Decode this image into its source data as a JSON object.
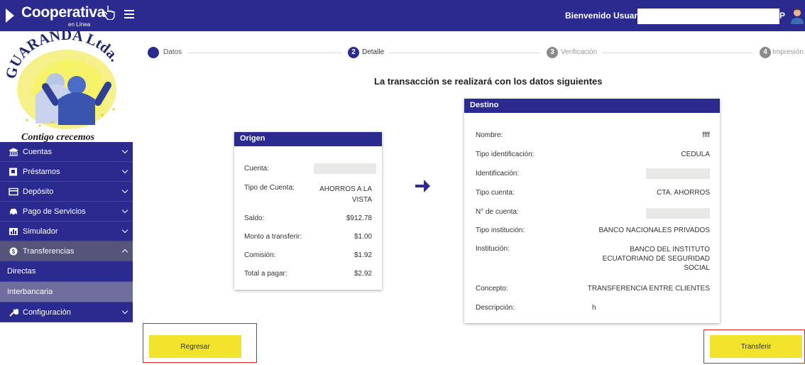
{
  "topbar": {
    "brand": "Cooperativa",
    "brand_sub": "en Línea",
    "welcome": "Bienvenido Usuario: F",
    "welcome_tail": "P"
  },
  "sidebar": {
    "logo_arc_text": "GUARANDA Ltda.",
    "logo_slogan": "Contigo crecemos",
    "items": [
      {
        "label": "Cuentas",
        "icon": "bank-icon"
      },
      {
        "label": "Préstamos",
        "icon": "document-icon"
      },
      {
        "label": "Depósito",
        "icon": "card-icon"
      },
      {
        "label": "Pago de Servicios",
        "icon": "car-icon"
      },
      {
        "label": "Simulador",
        "icon": "chart-icon"
      },
      {
        "label": "Transferencias",
        "icon": "dollar-circle-icon"
      }
    ],
    "sub_items": [
      {
        "label": "Directas"
      },
      {
        "label": "Interbancaria"
      }
    ],
    "config": {
      "label": "Configuración",
      "icon": "wrench-icon"
    }
  },
  "stepper": {
    "steps": [
      {
        "number": "",
        "label": "Datos",
        "color": "#2b2a8f"
      },
      {
        "number": "2",
        "label": "Detalle",
        "color": "#2b2a8f"
      },
      {
        "number": "3",
        "label": "Verificación",
        "color": "#8a8a8a"
      },
      {
        "number": "4",
        "label": "Impresión",
        "color": "#8a8a8a"
      }
    ]
  },
  "headline": "La transacción se realizará con los datos siguientes",
  "origen": {
    "title": "Origen",
    "rows": [
      {
        "label": "Cuenta:",
        "value": ""
      },
      {
        "label": "Tipo de Cuenta:",
        "value": "AHORROS A LA VISTA"
      },
      {
        "label": "Saldo:",
        "value": "$912.78"
      },
      {
        "label": "Monto a transferir:",
        "value": "$1.00"
      },
      {
        "label": "Comisión:",
        "value": "$1.92"
      },
      {
        "label": "Total a pagar:",
        "value": "$2.92"
      }
    ]
  },
  "destino": {
    "title": "Destino",
    "rows": [
      {
        "label": "Nombre:",
        "value": "ffff"
      },
      {
        "label": "Tipo identificación:",
        "value": "CEDULA"
      },
      {
        "label": "Identificación:",
        "value": ""
      },
      {
        "label": "Tipo cuenta:",
        "value": "CTA. AHORROS"
      },
      {
        "label": "N° de cuenta:",
        "value": ""
      },
      {
        "label": "Tipo institución:",
        "value": "BANCO NACIONALES PRIVADOS"
      },
      {
        "label": "Institución:",
        "value": "BANCO DEL INSTITUTO ECUATORIANO DE SEGURIDAD SOCIAL"
      },
      {
        "label": "Concepto:",
        "value": "TRANSFERENCIA ENTRE CLIENTES"
      },
      {
        "label": "Descripción:",
        "value": "h"
      }
    ]
  },
  "buttons": {
    "back": "Regresar",
    "transfer": "Transferir"
  },
  "colors": {
    "primary": "#2b2a8f",
    "button": "#f1e32c",
    "highlight": "#e02020"
  }
}
